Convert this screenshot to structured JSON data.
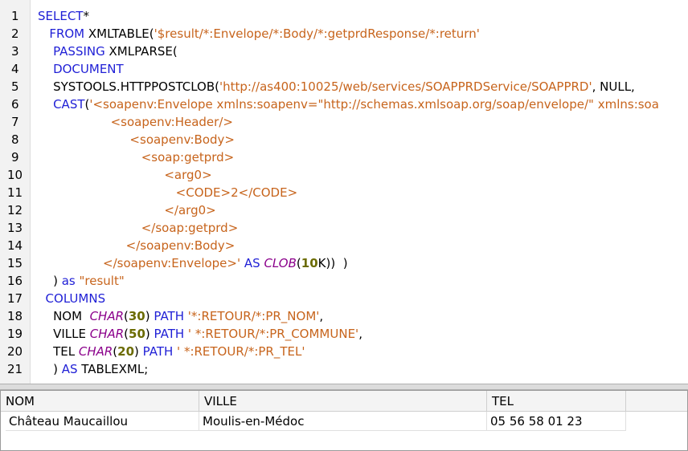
{
  "editor": {
    "line_numbers": [
      "1",
      "2",
      "3",
      "4",
      "5",
      "6",
      "7",
      "8",
      "9",
      "10",
      "11",
      "12",
      "13",
      "14",
      "15",
      "16",
      "17",
      "18",
      "19",
      "20",
      "21"
    ],
    "lines": [
      [
        {
          "t": "SELECT",
          "c": "kw"
        },
        {
          "t": "*",
          "c": "pl"
        }
      ],
      [
        {
          "t": "   ",
          "c": "pl"
        },
        {
          "t": "FROM",
          "c": "kw"
        },
        {
          "t": " XMLTABLE(",
          "c": "pl"
        },
        {
          "t": "'$result/*:Envelope/*:Body/*:getprdResponse/*:return'",
          "c": "str"
        }
      ],
      [
        {
          "t": "    ",
          "c": "pl"
        },
        {
          "t": "PASSING",
          "c": "kw"
        },
        {
          "t": " XMLPARSE(",
          "c": "pl"
        }
      ],
      [
        {
          "t": "    ",
          "c": "pl"
        },
        {
          "t": "DOCUMENT",
          "c": "kw"
        }
      ],
      [
        {
          "t": "    SYSTOOLS.HTTPPOSTCLOB(",
          "c": "pl"
        },
        {
          "t": "'http://as400:10025/web/services/SOAPPRDService/SOAPPRD'",
          "c": "str"
        },
        {
          "t": ", NULL,",
          "c": "pl"
        }
      ],
      [
        {
          "t": "    ",
          "c": "pl"
        },
        {
          "t": "CAST",
          "c": "kw"
        },
        {
          "t": "(",
          "c": "pl"
        },
        {
          "t": "'<soapenv:Envelope xmlns:soapenv=\"http://schemas.xmlsoap.org/soap/envelope/\" xmlns:soa",
          "c": "str"
        }
      ],
      [
        {
          "t": "                   <soapenv:Header/>",
          "c": "str"
        }
      ],
      [
        {
          "t": "                        <soapenv:Body>",
          "c": "str"
        }
      ],
      [
        {
          "t": "                           <soap:getprd>",
          "c": "str"
        }
      ],
      [
        {
          "t": "                                 <arg0>",
          "c": "str"
        }
      ],
      [
        {
          "t": "                                    <CODE>2</CODE>",
          "c": "str"
        }
      ],
      [
        {
          "t": "                                 </arg0>",
          "c": "str"
        }
      ],
      [
        {
          "t": "                           </soap:getprd>",
          "c": "str"
        }
      ],
      [
        {
          "t": "                       </soapenv:Body>",
          "c": "str"
        }
      ],
      [
        {
          "t": "                 </soapenv:Envelope>'",
          "c": "str"
        },
        {
          "t": " AS ",
          "c": "kw"
        },
        {
          "t": "CLOB",
          "c": "typ"
        },
        {
          "t": "(",
          "c": "pl"
        },
        {
          "t": "10",
          "c": "num"
        },
        {
          "t": "K))  )",
          "c": "pl"
        }
      ],
      [
        {
          "t": "    ) ",
          "c": "pl"
        },
        {
          "t": "as",
          "c": "kw"
        },
        {
          "t": " ",
          "c": "pl"
        },
        {
          "t": "\"result\"",
          "c": "str"
        }
      ],
      [
        {
          "t": "  ",
          "c": "pl"
        },
        {
          "t": "COLUMNS",
          "c": "kw"
        }
      ],
      [
        {
          "t": "    NOM  ",
          "c": "pl"
        },
        {
          "t": "CHAR",
          "c": "typ"
        },
        {
          "t": "(",
          "c": "pl"
        },
        {
          "t": "30",
          "c": "num"
        },
        {
          "t": ") ",
          "c": "pl"
        },
        {
          "t": "PATH",
          "c": "kw"
        },
        {
          "t": " ",
          "c": "pl"
        },
        {
          "t": "'*:RETOUR/*:PR_NOM'",
          "c": "str"
        },
        {
          "t": ",",
          "c": "pl"
        }
      ],
      [
        {
          "t": "    VILLE ",
          "c": "pl"
        },
        {
          "t": "CHAR",
          "c": "typ"
        },
        {
          "t": "(",
          "c": "pl"
        },
        {
          "t": "50",
          "c": "num"
        },
        {
          "t": ") ",
          "c": "pl"
        },
        {
          "t": "PATH",
          "c": "kw"
        },
        {
          "t": " ",
          "c": "pl"
        },
        {
          "t": "' *:RETOUR/*:PR_COMMUNE'",
          "c": "str"
        },
        {
          "t": ",",
          "c": "pl"
        }
      ],
      [
        {
          "t": "    TEL ",
          "c": "pl"
        },
        {
          "t": "CHAR",
          "c": "typ"
        },
        {
          "t": "(",
          "c": "pl"
        },
        {
          "t": "20",
          "c": "num"
        },
        {
          "t": ") ",
          "c": "pl"
        },
        {
          "t": "PATH",
          "c": "kw"
        },
        {
          "t": " ",
          "c": "pl"
        },
        {
          "t": "' *:RETOUR/*:PR_TEL'",
          "c": "str"
        }
      ],
      [
        {
          "t": "    ) ",
          "c": "pl"
        },
        {
          "t": "AS",
          "c": "kw"
        },
        {
          "t": " TABLEXML;",
          "c": "pl"
        }
      ]
    ]
  },
  "results": {
    "columns": [
      "NOM",
      "VILLE",
      "TEL"
    ],
    "rows": [
      [
        "Château Maucaillou",
        "Moulis-en-Médoc",
        "05 56 58 01 23"
      ]
    ]
  },
  "colors": {
    "keyword": "#1f1fd6",
    "string": "#c7641c",
    "type": "#8b008b",
    "number": "#6b6b00"
  }
}
